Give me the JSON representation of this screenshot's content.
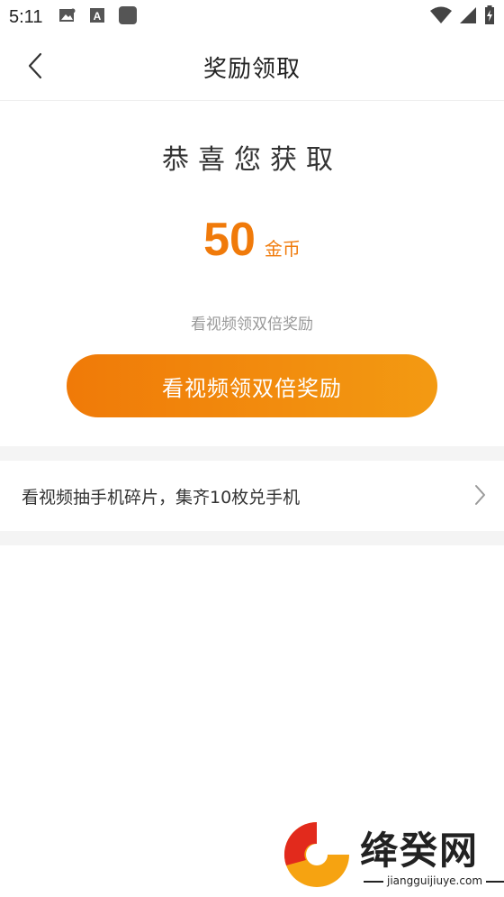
{
  "status_bar": {
    "time": "5:11",
    "icons_left": [
      "image-icon",
      "font-icon",
      "app-square-icon"
    ],
    "icons_right": [
      "wifi-icon",
      "signal-icon",
      "battery-icon"
    ]
  },
  "nav": {
    "title": "奖励领取",
    "back_icon": "chevron-left-icon"
  },
  "reward": {
    "congrats_text": "恭喜您获取",
    "amount": "50",
    "unit": "金币",
    "hint": "看视频领双倍奖励",
    "button_label": "看视频领双倍奖励"
  },
  "promo": {
    "text": "看视频抽手机碎片，集齐10枚兑手机",
    "arrow_icon": "chevron-right-icon"
  },
  "watermark": {
    "name": "绛癸网",
    "url": "jiangguijiuye.com"
  },
  "colors": {
    "accent": "#f07a0a",
    "button_gradient_start": "#f07a08",
    "button_gradient_end": "#f39a12",
    "divider": "#f4f4f4"
  }
}
